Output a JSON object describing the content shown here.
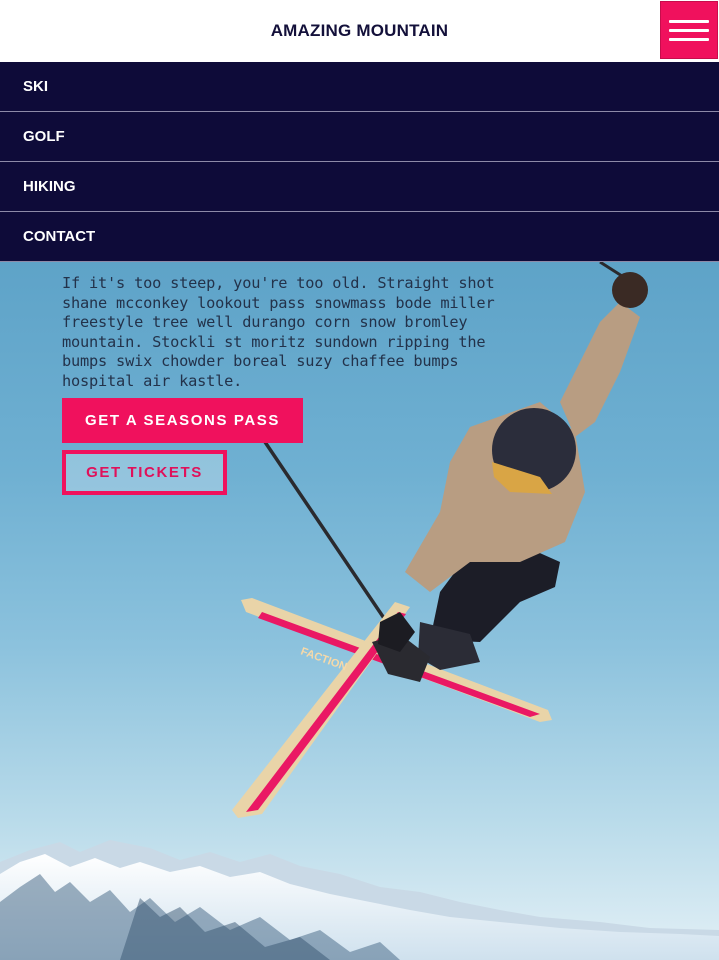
{
  "header": {
    "brand": "AMAZING MOUNTAIN",
    "menu_icon": "hamburger-menu-icon"
  },
  "nav": {
    "items": [
      {
        "label": "SKI"
      },
      {
        "label": "GOLF"
      },
      {
        "label": "HIKING"
      },
      {
        "label": "CONTACT"
      }
    ]
  },
  "hero": {
    "text": "If it's too steep, you're too old. Straight shot shane mcconkey lookout pass snowmass bode miller freestyle tree well durango corn snow bromley mountain. Stockli st moritz sundown ripping the bumps swix chowder boreal suzy chaffee bumps hospital air kastle.",
    "primary_cta": "GET A SEASONS PASS",
    "secondary_cta": "GET TICKETS",
    "ski_brand": "FACTION"
  },
  "colors": {
    "accent": "#f0115d",
    "nav_bg": "#0e0b39",
    "brand_text": "#13103a"
  }
}
